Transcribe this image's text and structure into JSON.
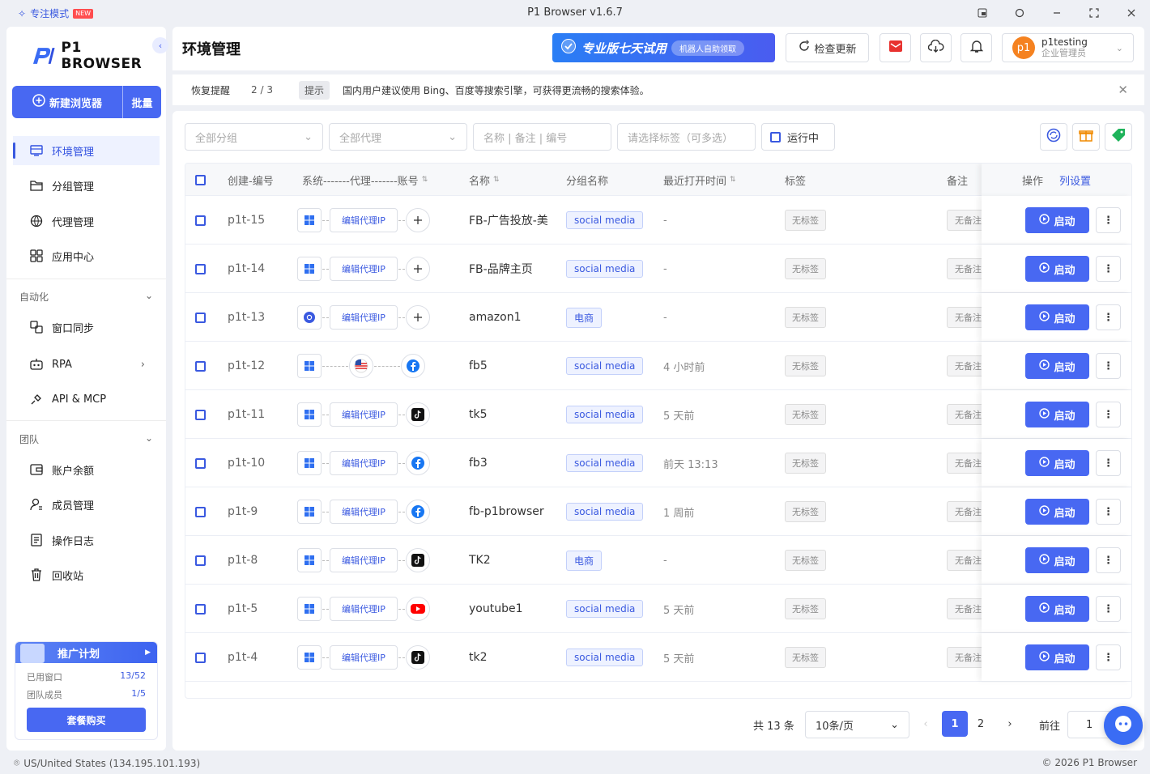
{
  "titlebar": {
    "focus_mode": "专注模式",
    "new_badge": "NEW",
    "window_title": "P1 Browser v1.6.7"
  },
  "sidebar": {
    "logo_text": "P1 BROWSER",
    "new_browser": "新建浏览器",
    "batch": "批量",
    "items": [
      {
        "label": "环境管理",
        "icon": "monitor-icon"
      },
      {
        "label": "分组管理",
        "icon": "folder-icon"
      },
      {
        "label": "代理管理",
        "icon": "globe-icon"
      },
      {
        "label": "应用中心",
        "icon": "apps-icon"
      }
    ],
    "automation_title": "自动化",
    "automation_items": [
      {
        "label": "窗口同步",
        "icon": "sync-window-icon"
      },
      {
        "label": "RPA",
        "icon": "robot-icon"
      },
      {
        "label": "API & MCP",
        "icon": "plug-icon"
      }
    ],
    "team_title": "团队",
    "team_items": [
      {
        "label": "账户余额",
        "icon": "wallet-icon"
      },
      {
        "label": "成员管理",
        "icon": "member-icon"
      },
      {
        "label": "操作日志",
        "icon": "log-icon"
      },
      {
        "label": "回收站",
        "icon": "trash-icon"
      }
    ],
    "promo": {
      "title": "推广计划",
      "used_windows_label": "已用窗口",
      "used_windows": "13/52",
      "members_label": "团队成员",
      "members": "1/5",
      "buy": "套餐购买"
    }
  },
  "header": {
    "title": "环境管理",
    "trial": "专业版七天试用",
    "trial_pill": "机器人自助领取",
    "check_update": "检查更新",
    "user_name": "p1testing",
    "user_role": "企业管理员",
    "avatar": "p1"
  },
  "notice": {
    "label": "恢复提醒",
    "count": "2 / 3",
    "tip": "提示",
    "message": "国内用户建议使用 Bing、百度等搜索引擎，可获得更流畅的搜索体验。"
  },
  "filters": {
    "group": "全部分组",
    "proxy": "全部代理",
    "search_placeholder": "名称 | 备注 | 编号",
    "tags_placeholder": "请选择标签（可多选）",
    "running": "运行中"
  },
  "table": {
    "headers": {
      "id": "创建-编号",
      "system": "系统-------代理-------账号",
      "name": "名称",
      "group": "分组名称",
      "last_open": "最近打开时间",
      "tags": "标签",
      "remark": "备注",
      "ops": "操作",
      "col_settings": "列设置"
    },
    "proxy_label": "编辑代理IP",
    "start_label": "启动",
    "rows": [
      {
        "id": "p1t-15",
        "os": "windows",
        "proxy": "edit",
        "account": "add",
        "name": "FB-广告投放-美",
        "group": "social media",
        "last_open": "-",
        "tag": "无标签",
        "remark": "无备注"
      },
      {
        "id": "p1t-14",
        "os": "windows",
        "proxy": "edit",
        "account": "add",
        "name": "FB-品牌主页",
        "group": "social media",
        "last_open": "-",
        "tag": "无标签",
        "remark": "无备注"
      },
      {
        "id": "p1t-13",
        "os": "chromium",
        "proxy": "edit",
        "account": "add",
        "name": "amazon1",
        "group": "电商",
        "last_open": "-",
        "tag": "无标签",
        "remark": "无备注"
      },
      {
        "id": "p1t-12",
        "os": "windows",
        "proxy": "us-flag",
        "account": "facebook",
        "name": "fb5",
        "group": "social media",
        "last_open": "4 小时前",
        "tag": "无标签",
        "remark": "无备注"
      },
      {
        "id": "p1t-11",
        "os": "windows",
        "proxy": "edit",
        "account": "tiktok",
        "name": "tk5",
        "group": "social media",
        "last_open": "5 天前",
        "tag": "无标签",
        "remark": "无备注"
      },
      {
        "id": "p1t-10",
        "os": "windows",
        "proxy": "edit",
        "account": "facebook",
        "name": "fb3",
        "group": "social media",
        "last_open": "前天 13:13",
        "tag": "无标签",
        "remark": "无备注"
      },
      {
        "id": "p1t-9",
        "os": "windows",
        "proxy": "edit",
        "account": "facebook",
        "name": "fb-p1browser",
        "group": "social media",
        "last_open": "1 周前",
        "tag": "无标签",
        "remark": "无备注"
      },
      {
        "id": "p1t-8",
        "os": "windows",
        "proxy": "edit",
        "account": "tiktok",
        "name": "TK2",
        "group": "电商",
        "last_open": "-",
        "tag": "无标签",
        "remark": "无备注"
      },
      {
        "id": "p1t-5",
        "os": "windows",
        "proxy": "edit",
        "account": "youtube",
        "name": "youtube1",
        "group": "social media",
        "last_open": "5 天前",
        "tag": "无标签",
        "remark": "无备注"
      },
      {
        "id": "p1t-4",
        "os": "windows",
        "proxy": "edit",
        "account": "tiktok",
        "name": "tk2",
        "group": "social media",
        "last_open": "5 天前",
        "tag": "无标签",
        "remark": "无备注"
      }
    ]
  },
  "pagination": {
    "total": "共 13 条",
    "page_size": "10条/页",
    "pages": [
      "1",
      "2"
    ],
    "current": "1",
    "goto_label": "前往",
    "goto_value": "1"
  },
  "statusbar": {
    "location": "US/United States (134.195.101.193)",
    "copyright": "© 2026 P1 Browser"
  },
  "colors": {
    "accent": "#4868f2",
    "brand_blue": "#3a59e0"
  }
}
